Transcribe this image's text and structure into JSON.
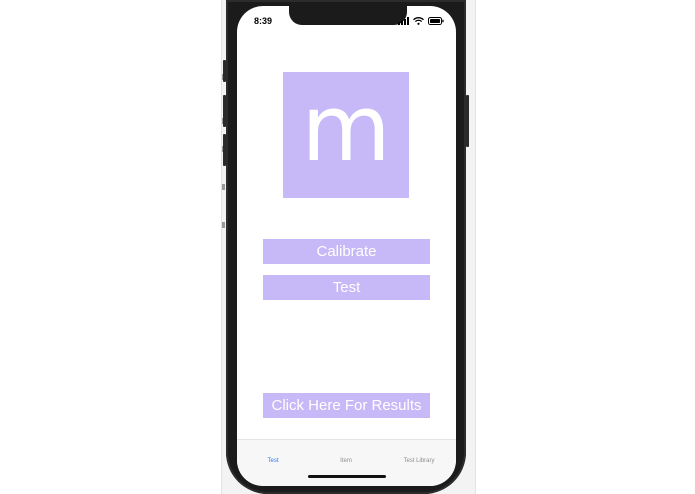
{
  "status_bar": {
    "time": "8:39",
    "icons": [
      "signal-icon",
      "wifi-icon",
      "battery-icon"
    ]
  },
  "logo": {
    "letter": "m",
    "color": "#c7b8f7"
  },
  "buttons": {
    "calibrate": "Calibrate",
    "test": "Test",
    "results": "Click Here For Results"
  },
  "tab_bar": {
    "active_color": "#2f7cf6",
    "tabs": [
      {
        "label": "Test",
        "active": true
      },
      {
        "label": "Item",
        "active": false
      },
      {
        "label": "Test Library",
        "active": false
      }
    ]
  }
}
